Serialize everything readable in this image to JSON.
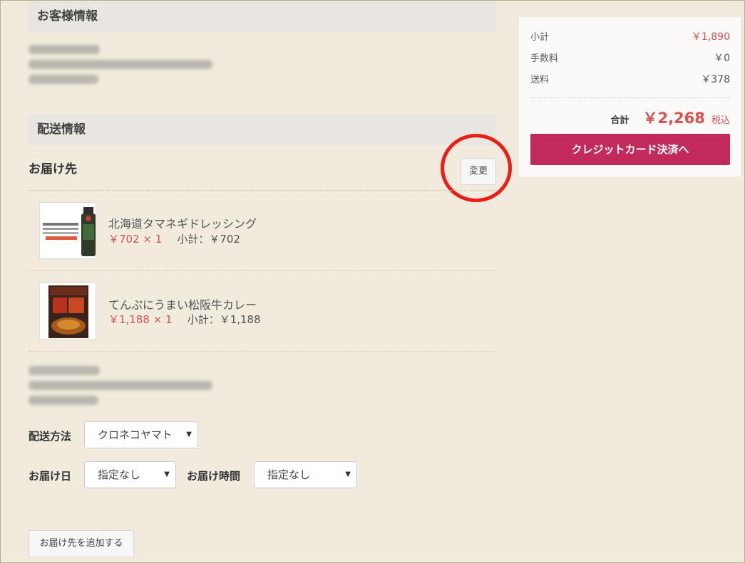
{
  "customer_section": {
    "title": "お客様情報"
  },
  "delivery_section": {
    "title": "配送情報",
    "destination_label": "お届け先",
    "change_button": "変更"
  },
  "items": [
    {
      "name": "北海道タマネギドレッシング",
      "price_qty": "￥702 × 1",
      "subtotal": "小計：￥702"
    },
    {
      "name": "てんぷにうまい松阪牛カレー",
      "price_qty": "￥1,188 × 1",
      "subtotal": "小計：￥1,188"
    }
  ],
  "shipping": {
    "method_label": "配送方法",
    "method_value": "クロネコヤマト",
    "date_label": "お届け日",
    "date_value": "指定なし",
    "time_label": "お届け時間",
    "time_value": "指定なし",
    "add_destination_button": "お届け先を追加する"
  },
  "summary": {
    "subtotal_label": "小計",
    "subtotal_value": "￥1,890",
    "fee_label": "手数料",
    "fee_value": "￥0",
    "shipping_label": "送料",
    "shipping_value": "￥378",
    "total_label": "合計",
    "total_value": "￥2,268",
    "tax_label": "税込",
    "checkout_button": "クレジットカード決済へ"
  },
  "colors": {
    "accent": "#c12a5b",
    "price": "#d9534f",
    "highlight_circle": "#ee1c14"
  }
}
